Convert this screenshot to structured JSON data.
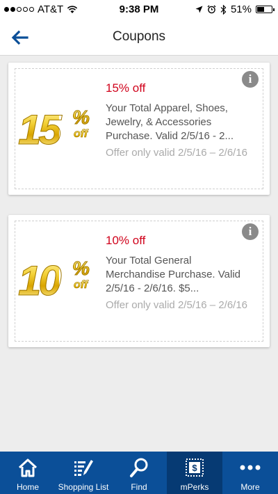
{
  "status_bar": {
    "carrier": "AT&T",
    "time": "9:38 PM",
    "battery": "51%",
    "battery_level": 0.51
  },
  "nav": {
    "title": "Coupons",
    "back_icon": "back-arrow-icon"
  },
  "coupons": [
    {
      "badge_number": "15",
      "badge_percent": "%",
      "badge_off": "off",
      "title": "15% off",
      "description": "Your Total Apparel, Shoes, Jewelry, & Accessories Purchase. Valid 2/5/16 - 2...",
      "validity": "Offer only valid 2/5/16 – 2/6/16",
      "info_icon": "info-icon"
    },
    {
      "badge_number": "10",
      "badge_percent": "%",
      "badge_off": "off",
      "title": "10% off",
      "description": "Your Total General Merchandise Purchase. Valid 2/5/16 - 2/6/16. $5...",
      "validity": "Offer only valid 2/5/16 – 2/6/16",
      "info_icon": "info-icon"
    }
  ],
  "tabs": [
    {
      "label": "Home",
      "icon": "home-icon"
    },
    {
      "label": "Shopping List",
      "icon": "list-edit-icon"
    },
    {
      "label": "Find",
      "icon": "magnifier-icon"
    },
    {
      "label": "mPerks",
      "icon": "stamp-dollar-icon",
      "active": true
    },
    {
      "label": "More",
      "icon": "more-dots-icon"
    }
  ],
  "colors": {
    "tab_bar": "#0b4f98",
    "tab_active": "#063a73",
    "coupon_title": "#d0021b",
    "back_arrow": "#0b4f98"
  }
}
